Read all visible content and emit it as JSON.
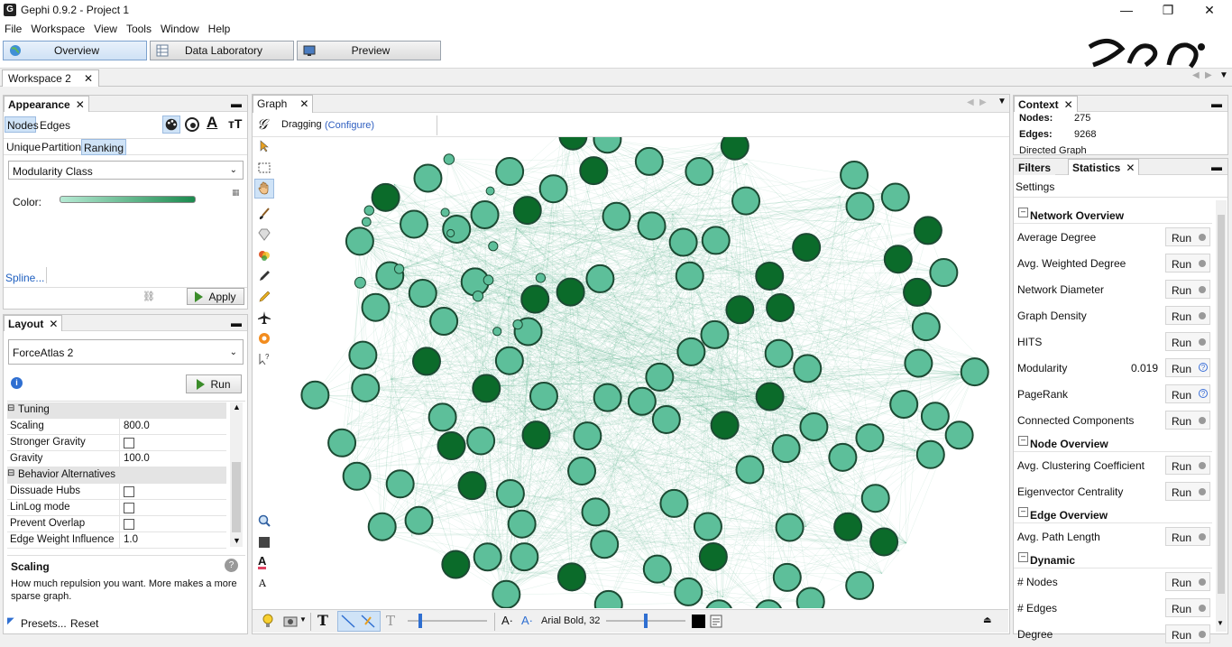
{
  "window": {
    "title": "Gephi 0.9.2 - Project 1",
    "minimize": "—",
    "maximize": "❐",
    "close": "✕"
  },
  "menu": [
    "File",
    "Workspace",
    "View",
    "Tools",
    "Window",
    "Help"
  ],
  "modes": {
    "overview": "Overview",
    "data_lab": "Data Laboratory",
    "preview": "Preview"
  },
  "workspace_tab": "Workspace 2",
  "appearance": {
    "title": "Appearance",
    "tab_nodes": "Nodes",
    "tab_edges": "Edges",
    "sub_unique": "Unique",
    "sub_partition": "Partition",
    "sub_ranking": "Ranking",
    "attribute": "Modularity Class",
    "color_label": "Color:",
    "spline": "Spline...",
    "apply": "Apply",
    "gradient_start": "#b6ead4",
    "gradient_end": "#1b8a4e"
  },
  "layout": {
    "title": "Layout",
    "algorithm": "ForceAtlas 2",
    "run": "Run",
    "props": [
      {
        "key": "Tuning",
        "section": true
      },
      {
        "key": "Scaling",
        "value": "800.0"
      },
      {
        "key": "Stronger Gravity",
        "check": true
      },
      {
        "key": "Gravity",
        "value": "100.0"
      },
      {
        "key": "Behavior Alternatives",
        "section": true
      },
      {
        "key": "Dissuade Hubs",
        "check": true
      },
      {
        "key": "LinLog mode",
        "check": true
      },
      {
        "key": "Prevent Overlap",
        "check": true
      },
      {
        "key": "Edge Weight Influence",
        "value": "1.0"
      }
    ],
    "desc_title": "Scaling",
    "desc_text": "How much repulsion you want. More makes a more sparse graph.",
    "presets": "Presets...",
    "reset": "Reset"
  },
  "graph": {
    "title": "Graph",
    "mode": "Dragging",
    "configure": "(Configure)",
    "font_label": "Arial Bold, 32",
    "node_light": "#5dbf9a",
    "node_dark": "#0b6b2a",
    "edge_color": "#2a9a6a"
  },
  "context": {
    "title": "Context",
    "nodes_label": "Nodes:",
    "nodes_value": "275",
    "edges_label": "Edges:",
    "edges_value": "9268",
    "type": "Directed Graph"
  },
  "statistics": {
    "filters_tab": "Filters",
    "stats_tab": "Statistics",
    "settings": "Settings",
    "sections": [
      {
        "title": "Network Overview",
        "items": [
          {
            "label": "Average Degree",
            "run": "Run"
          },
          {
            "label": "Avg. Weighted Degree",
            "run": "Run"
          },
          {
            "label": "Network Diameter",
            "run": "Run"
          },
          {
            "label": "Graph Density",
            "run": "Run"
          },
          {
            "label": "HITS",
            "run": "Run"
          },
          {
            "label": "Modularity",
            "value": "0.019",
            "run": "Run",
            "help": true
          },
          {
            "label": "PageRank",
            "run": "Run",
            "help": true
          },
          {
            "label": "Connected Components",
            "run": "Run"
          }
        ]
      },
      {
        "title": "Node Overview",
        "items": [
          {
            "label": "Avg. Clustering Coefficient",
            "run": "Run"
          },
          {
            "label": "Eigenvector Centrality",
            "run": "Run"
          }
        ]
      },
      {
        "title": "Edge Overview",
        "items": [
          {
            "label": "Avg. Path Length",
            "run": "Run"
          }
        ]
      },
      {
        "title": "Dynamic",
        "items": [
          {
            "label": "# Nodes",
            "run": "Run"
          },
          {
            "label": "# Edges",
            "run": "Run"
          },
          {
            "label": "Degree",
            "run": "Run"
          }
        ]
      }
    ]
  }
}
